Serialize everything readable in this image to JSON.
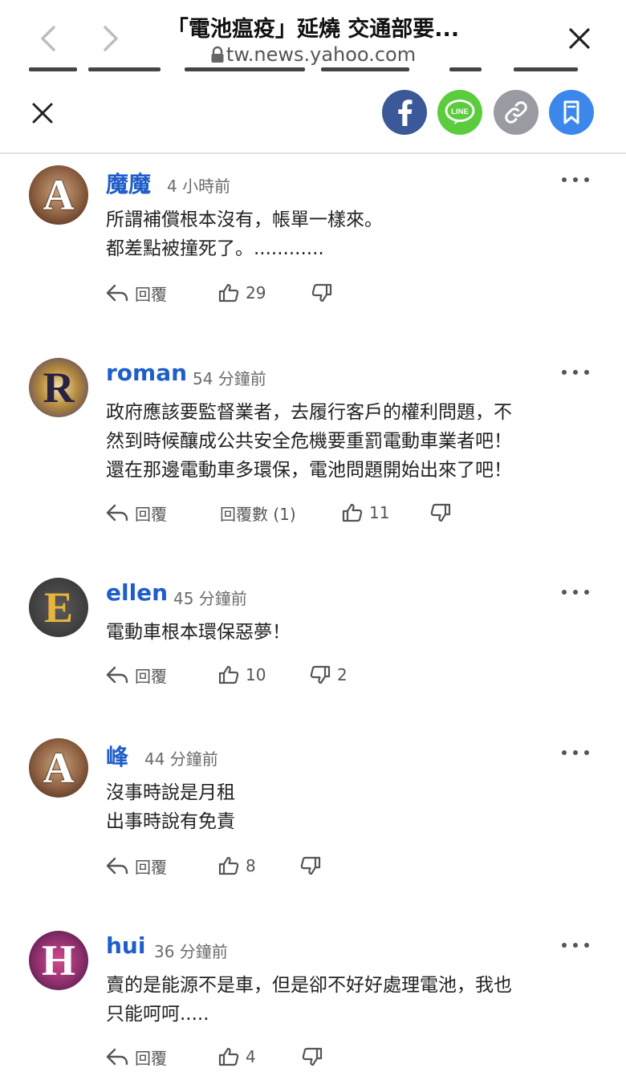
{
  "browser": {
    "page_title": "「電池瘟疫」延燒 交通部要...",
    "domain": "tw.news.yahoo.com",
    "back_icon": "chevron-left-icon",
    "forward_icon": "chevron-right-icon",
    "close_icon": "close-icon"
  },
  "share_bar": {
    "close_icon": "close-icon",
    "buttons": [
      {
        "name": "facebook",
        "icon": "facebook-icon",
        "color": "#3b5998"
      },
      {
        "name": "line",
        "icon": "line-icon",
        "label": "LINE",
        "color": "#5ccc3f"
      },
      {
        "name": "copy-link",
        "icon": "link-icon",
        "color": "#9a9ba2"
      },
      {
        "name": "bookmark",
        "icon": "bookmark-icon",
        "color": "#3b87ec"
      }
    ]
  },
  "actions": {
    "reply_label": "回覆"
  },
  "comments": [
    {
      "avatar_letter": "A",
      "username": "魔魔",
      "time": "4 小時前",
      "lines": [
        "所謂補償根本沒有，帳單一樣來。",
        "都差點被撞死了。............"
      ],
      "likes": "29",
      "dislikes": "",
      "replies_label": ""
    },
    {
      "avatar_letter": "R",
      "username": "roman",
      "time": "54 分鐘前",
      "lines": [
        "政府應該要監督業者，去履行客戶的權利問題，不",
        "然到時候釀成公共安全危機要重罰電動車業者吧！",
        "還在那邊電動車多環保，電池問題開始出來了吧！"
      ],
      "likes": "11",
      "dislikes": "",
      "replies_label": "回覆數 (1)"
    },
    {
      "avatar_letter": "E",
      "username": "ellen",
      "time": "45 分鐘前",
      "lines": [
        "電動車根本環保惡夢！"
      ],
      "likes": "10",
      "dislikes": "2",
      "replies_label": ""
    },
    {
      "avatar_letter": "A",
      "username": "峰",
      "time": "44 分鐘前",
      "lines": [
        "沒事時說是月租",
        "出事時說有免責"
      ],
      "likes": "8",
      "dislikes": "",
      "replies_label": ""
    },
    {
      "avatar_letter": "H",
      "username": "hui",
      "time": "36 分鐘前",
      "lines": [
        "賣的是能源不是車，但是卻不好好處理電池，我也",
        "只能呵呵....."
      ],
      "likes": "4",
      "dislikes": "",
      "replies_label": ""
    }
  ]
}
